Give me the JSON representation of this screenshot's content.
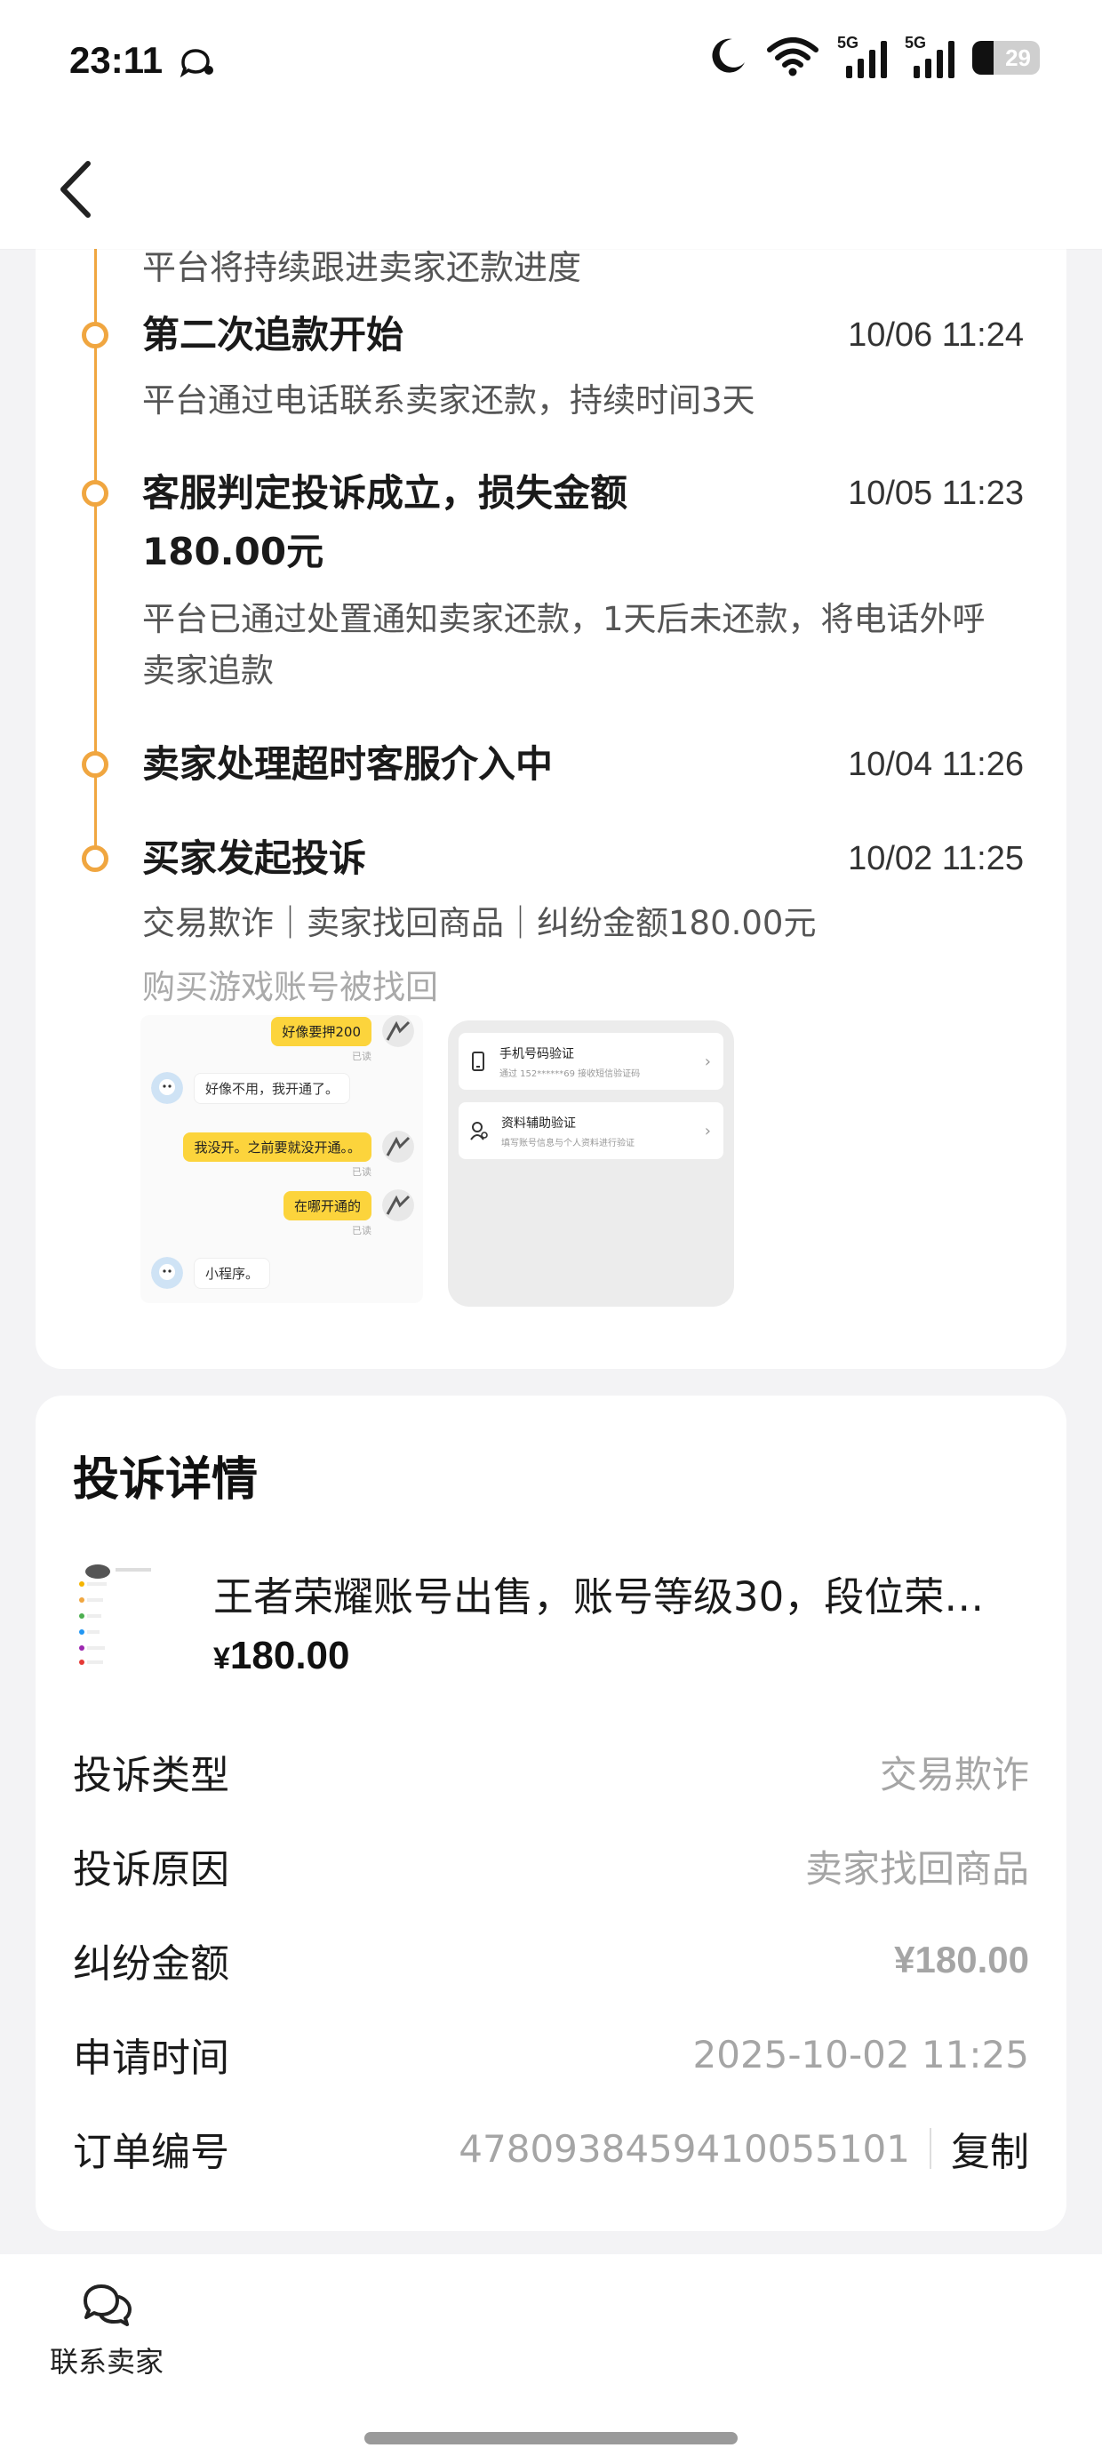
{
  "status_bar": {
    "time": "23:11",
    "network_1": "5G",
    "network_2": "5G",
    "battery": "29"
  },
  "timeline": {
    "cut_off_text": "平台将持续跟进卖家还款进度",
    "events": [
      {
        "title": "第二次追款开始",
        "time": "10/06 11:24",
        "desc": "平台通过电话联系卖家还款，持续时间3天"
      },
      {
        "title_line1": "客服判定投诉成立，损失金额",
        "title_line2": "180.00元",
        "time": "10/05 11:23",
        "desc_line1": "平台已通过处置通知卖家还款，1天后未还款，将电话外呼",
        "desc_line2": "卖家追款"
      },
      {
        "title": "卖家处理超时客服介入中",
        "time": "10/04 11:26"
      },
      {
        "title": "买家发起投诉",
        "time": "10/02 11:25",
        "desc": "交易欺诈｜卖家找回商品｜纠纷金额180.00元",
        "note": "购买游戏账号被找回"
      }
    ],
    "evidence_chat": {
      "messages": [
        "好像要押200",
        "好像不用，我开通了。",
        "我没开。之前要就没开通。。",
        "在哪开通的",
        "小程序。"
      ],
      "read_label": "已读"
    },
    "evidence_verify": {
      "items": [
        {
          "title": "手机号码验证",
          "sub": "通过 152******69 接收短信验证码"
        },
        {
          "title": "资料辅助验证",
          "sub": "填写账号信息与个人资料进行验证"
        }
      ]
    }
  },
  "detail": {
    "title": "投诉详情",
    "product_name": "王者荣耀账号出售，账号等级30，段位荣…",
    "price_symbol": "¥",
    "price": "180.00",
    "rows": [
      {
        "label": "投诉类型",
        "value": "交易欺诈"
      },
      {
        "label": "投诉原因",
        "value": "卖家找回商品"
      },
      {
        "label": "纠纷金额",
        "value": "¥180.00"
      },
      {
        "label": "申请时间",
        "value": "2025-10-02 11:25"
      },
      {
        "label": "订单编号",
        "value": "4780938459410055101"
      }
    ],
    "copy_label": "复制"
  },
  "bottom_bar": {
    "contact_label": "联系卖家"
  },
  "colors": {
    "accent_orange": "#f0a640",
    "chat_yellow": "#fcd43c",
    "muted_text": "#a5a5a5"
  },
  "icons": [
    "chat-status-icon",
    "moon-icon",
    "wifi-icon",
    "back-arrow-icon",
    "chat-bubbles-icon",
    "phone-icon",
    "user-verify-icon"
  ]
}
